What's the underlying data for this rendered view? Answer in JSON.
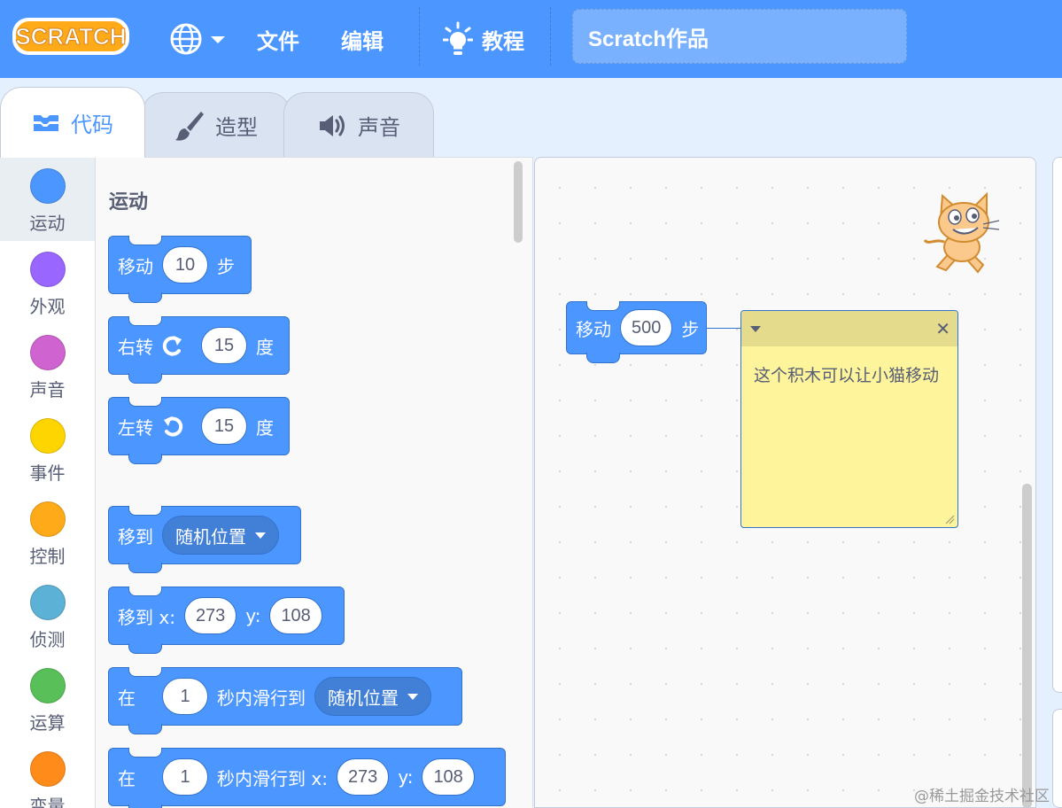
{
  "menubar": {
    "logo_text": "SCRATCH",
    "file_label": "文件",
    "edit_label": "编辑",
    "tutorials_label": "教程",
    "project_title": "Scratch作品"
  },
  "tabs": [
    {
      "label": "代码",
      "icon": "code-icon",
      "active": true
    },
    {
      "label": "造型",
      "icon": "brush-icon",
      "active": false
    },
    {
      "label": "声音",
      "icon": "speaker-icon",
      "active": false
    }
  ],
  "categories": [
    {
      "label": "运动",
      "color": "#4c97ff",
      "selected": true
    },
    {
      "label": "外观",
      "color": "#9966ff",
      "selected": false
    },
    {
      "label": "声音",
      "color": "#cf63cf",
      "selected": false
    },
    {
      "label": "事件",
      "color": "#ffd500",
      "selected": false
    },
    {
      "label": "控制",
      "color": "#ffab19",
      "selected": false
    },
    {
      "label": "侦测",
      "color": "#5cb1d6",
      "selected": false
    },
    {
      "label": "运算",
      "color": "#59c059",
      "selected": false
    },
    {
      "label": "变量",
      "color": "#ff8c1a",
      "selected": false
    }
  ],
  "palette": {
    "section_title": "运动",
    "blocks": {
      "move": {
        "prefix": "移动",
        "value": "10",
        "suffix": "步"
      },
      "turn_right": {
        "prefix": "右转",
        "value": "15",
        "suffix": "度"
      },
      "turn_left": {
        "prefix": "左转",
        "value": "15",
        "suffix": "度"
      },
      "goto": {
        "prefix": "移到",
        "menu": "随机位置"
      },
      "goto_xy": {
        "prefix": "移到 x:",
        "x": "273",
        "ylabel": "y:",
        "y": "108"
      },
      "glide": {
        "prefix": "在",
        "secs": "1",
        "mid": "秒内滑行到",
        "menu": "随机位置"
      },
      "glide_xy": {
        "prefix": "在",
        "secs": "1",
        "mid": "秒内滑行到 x:",
        "x": "273",
        "ylabel": "y:",
        "y": "108"
      }
    }
  },
  "workspace": {
    "block": {
      "prefix": "移动",
      "value": "500",
      "suffix": "步"
    },
    "comment": {
      "text": "这个积木可以让小猫移动"
    }
  },
  "watermark": "@稀土掘金技术社区",
  "colors": {
    "brand": "#4c97ff",
    "menubar": "#4c97ff",
    "note": "#fef49c"
  }
}
